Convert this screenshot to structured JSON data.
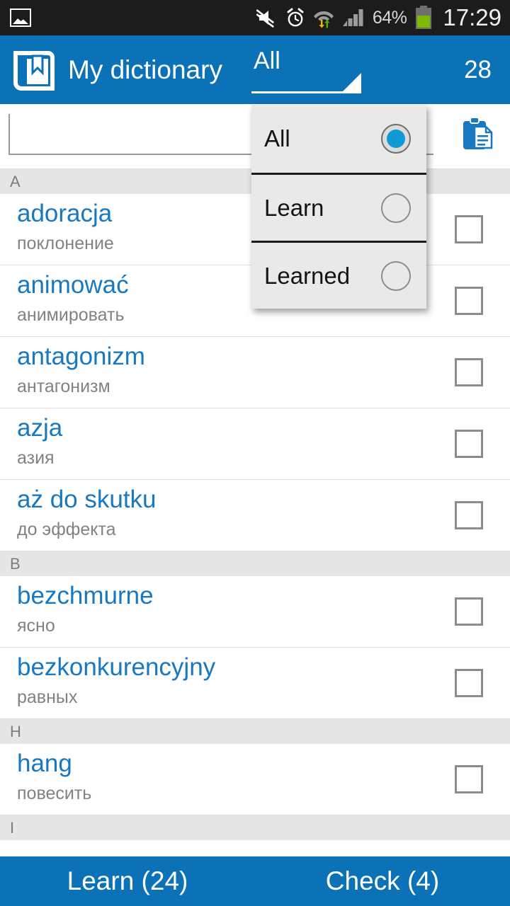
{
  "statusbar": {
    "time": "17:29",
    "battery_percent": "64%",
    "icons": [
      "photo-icon",
      "mute-icon",
      "alarm-icon",
      "wifi-data-icon",
      "signal-icon",
      "battery-icon"
    ]
  },
  "appbar": {
    "logo_icon": "book-bookmark-icon",
    "title": "My dictionary",
    "spinner_value": "All",
    "spinner_caret_icon": "dropdown-triangle-icon",
    "count": "28"
  },
  "toolbar": {
    "search_value": "",
    "search_placeholder": "",
    "clipboard_icon": "clipboard-icon"
  },
  "dropdown": {
    "open": true,
    "selected": "All",
    "items": [
      {
        "label": "All",
        "selected": true
      },
      {
        "label": "Learn",
        "selected": false
      },
      {
        "label": "Learned",
        "selected": false
      }
    ]
  },
  "list": {
    "sections": [
      {
        "letter": "A",
        "entries": [
          {
            "term": "adoracja",
            "translation": "поклонение",
            "checked": false
          },
          {
            "term": "animować",
            "translation": "анимировать",
            "checked": false
          },
          {
            "term": "antagonizm",
            "translation": "антагонизм",
            "checked": false
          },
          {
            "term": "azja",
            "translation": "азия",
            "checked": false
          },
          {
            "term": "aż do skutku",
            "translation": "до эффекта",
            "checked": false
          }
        ]
      },
      {
        "letter": "B",
        "entries": [
          {
            "term": "bezchmurne",
            "translation": "ясно",
            "checked": false
          },
          {
            "term": "bezkonkurencyjny",
            "translation": "равных",
            "checked": false
          }
        ]
      },
      {
        "letter": "H",
        "entries": [
          {
            "term": "hang",
            "translation": "повесить",
            "checked": false
          }
        ]
      },
      {
        "letter": "I",
        "entries": []
      }
    ]
  },
  "bottombar": {
    "learn_label": "Learn (24)",
    "check_label": "Check (4)"
  },
  "colors": {
    "brand_blue": "#0b72b8",
    "term_blue": "#1878c0",
    "radio_blue": "#0f9ad6",
    "statusbar_bg": "#1c1c1c",
    "section_bg": "#e6e6e6",
    "dropdown_bg": "#e9e9e9"
  }
}
